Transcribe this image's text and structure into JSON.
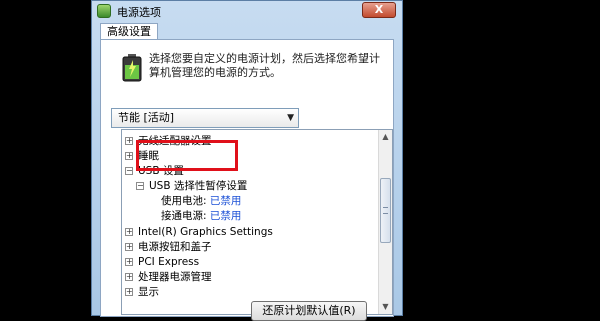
{
  "window": {
    "title": "电源选项",
    "close_label": "X"
  },
  "tab": {
    "label": "高级设置"
  },
  "description": "选择您要自定义的电源计划，然后选择您希望计算机管理您的电源的方式。",
  "plan_select": {
    "value": "节能 [活动]"
  },
  "tree": {
    "items": [
      {
        "expander": "+",
        "label": "无线适配器设置"
      },
      {
        "expander": "+",
        "label": "睡眠"
      },
      {
        "expander": "−",
        "label": "USB 设置"
      },
      {
        "expander": "−",
        "label": "USB 选择性暂停设置"
      },
      {
        "label": "使用电池:",
        "value": "已禁用"
      },
      {
        "label": "接通电源:",
        "value": "已禁用"
      },
      {
        "expander": "+",
        "label": "Intel(R) Graphics Settings"
      },
      {
        "expander": "+",
        "label": "电源按钮和盖子"
      },
      {
        "expander": "+",
        "label": "PCI Express"
      },
      {
        "expander": "+",
        "label": "处理器电源管理"
      },
      {
        "expander": "+",
        "label": "显示"
      }
    ]
  },
  "restore_button": {
    "label": "还原计划默认值(R)"
  },
  "colors": {
    "value_link": "#1a4fd6",
    "highlight": "#e0101a",
    "title_bar": "#c7dcf1"
  }
}
